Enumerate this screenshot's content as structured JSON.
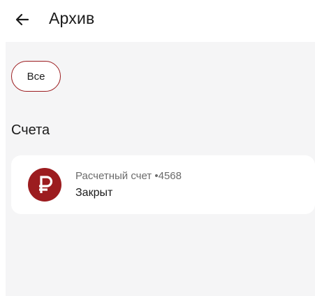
{
  "header": {
    "title": "Архив",
    "back_icon": "arrow-left-icon"
  },
  "filters": {
    "chips": [
      {
        "label": "Все",
        "selected": true
      }
    ]
  },
  "accounts": {
    "section_title": "Счета",
    "items": [
      {
        "icon": "ruble-icon",
        "name": "Расчетный счет •4568",
        "status": "Закрыт"
      }
    ]
  },
  "colors": {
    "accent": "#9c1c1f",
    "background": "#f5f5f6",
    "card": "#ffffff"
  }
}
